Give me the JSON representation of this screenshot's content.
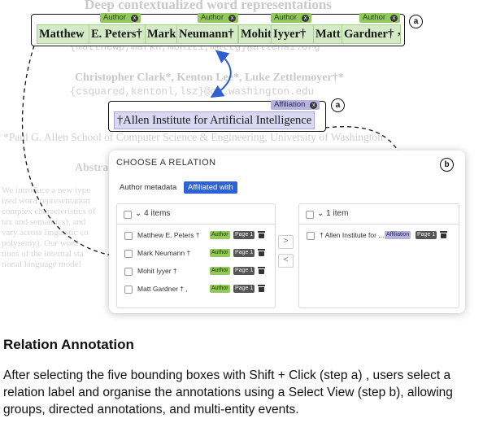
{
  "paper": {
    "title": "Deep contextualized word representations",
    "emails": "{matthewp,markn,mohiti,mattg}@allenai.org",
    "authors_line2": "Christopher Clark*, Kenton Lee*, Luke Zettlemoyer†*",
    "emails_line2": "{csquared,kentonl,lsz}@cs.washington.edu",
    "affiliation_line2": "*Paul G. Allen School of Computer Science & Engineering, University of Washington",
    "abstract_heading": "Abstract",
    "body_lines": [
      "We introduce a new type",
      "ized word representation",
      "complex characteristics of",
      "tax and semantics), and",
      "vary across linguistic co",
      "polysemy). Our word",
      "tions of the internal sta",
      "tional language model"
    ]
  },
  "authors": [
    {
      "text": "Matthew",
      "label": "Author"
    },
    {
      "text": "E. Peters†",
      "label": "Author"
    },
    {
      "text": "Mark",
      "label": "Author"
    },
    {
      "text": "Neumann†",
      "label": "Author"
    },
    {
      "text": "Mohit",
      "label": "Author"
    },
    {
      "text": "Iyyer†",
      "label": "Author"
    },
    {
      "text": "Matt",
      "label": "Author"
    },
    {
      "text": "Gardner†",
      "label": "Author"
    }
  ],
  "author_box_suffix": ",",
  "affiliation": {
    "text": "†Allen Institute for Artificial Intelligence",
    "label": "Affiliation"
  },
  "step_labels": {
    "a": "a",
    "b": "b"
  },
  "dialog": {
    "title": "CHOOSE A RELATION",
    "tabs": [
      "Author metadata",
      "Affiliated with"
    ],
    "active_tab": "Affiliated with",
    "left": {
      "header": "4 items",
      "rows": [
        {
          "name": "Matthew E. Peters †",
          "tag": "Author",
          "page": "Page 1"
        },
        {
          "name": "Mark Neumann †",
          "tag": "Author",
          "page": "Page 1"
        },
        {
          "name": "Mohit Iyyer †",
          "tag": "Author",
          "page": "Page 1"
        },
        {
          "name": "Matt Gardner † ,",
          "tag": "Author",
          "page": "Page 1"
        }
      ]
    },
    "right": {
      "header": "1 item",
      "rows": [
        {
          "name": "† Allen Institute for ...",
          "tag": "Affiliation",
          "page": "Page 1"
        }
      ]
    },
    "move_right": ">",
    "move_left": "<"
  },
  "caption": {
    "title": "Relation Annotation",
    "text": "After selecting the five bounding boxes with Shift + Click (step a) , users select a relation label and organise the annotations using a Select View (step b), allowing groups, directed annotations, and multi-entity events."
  }
}
